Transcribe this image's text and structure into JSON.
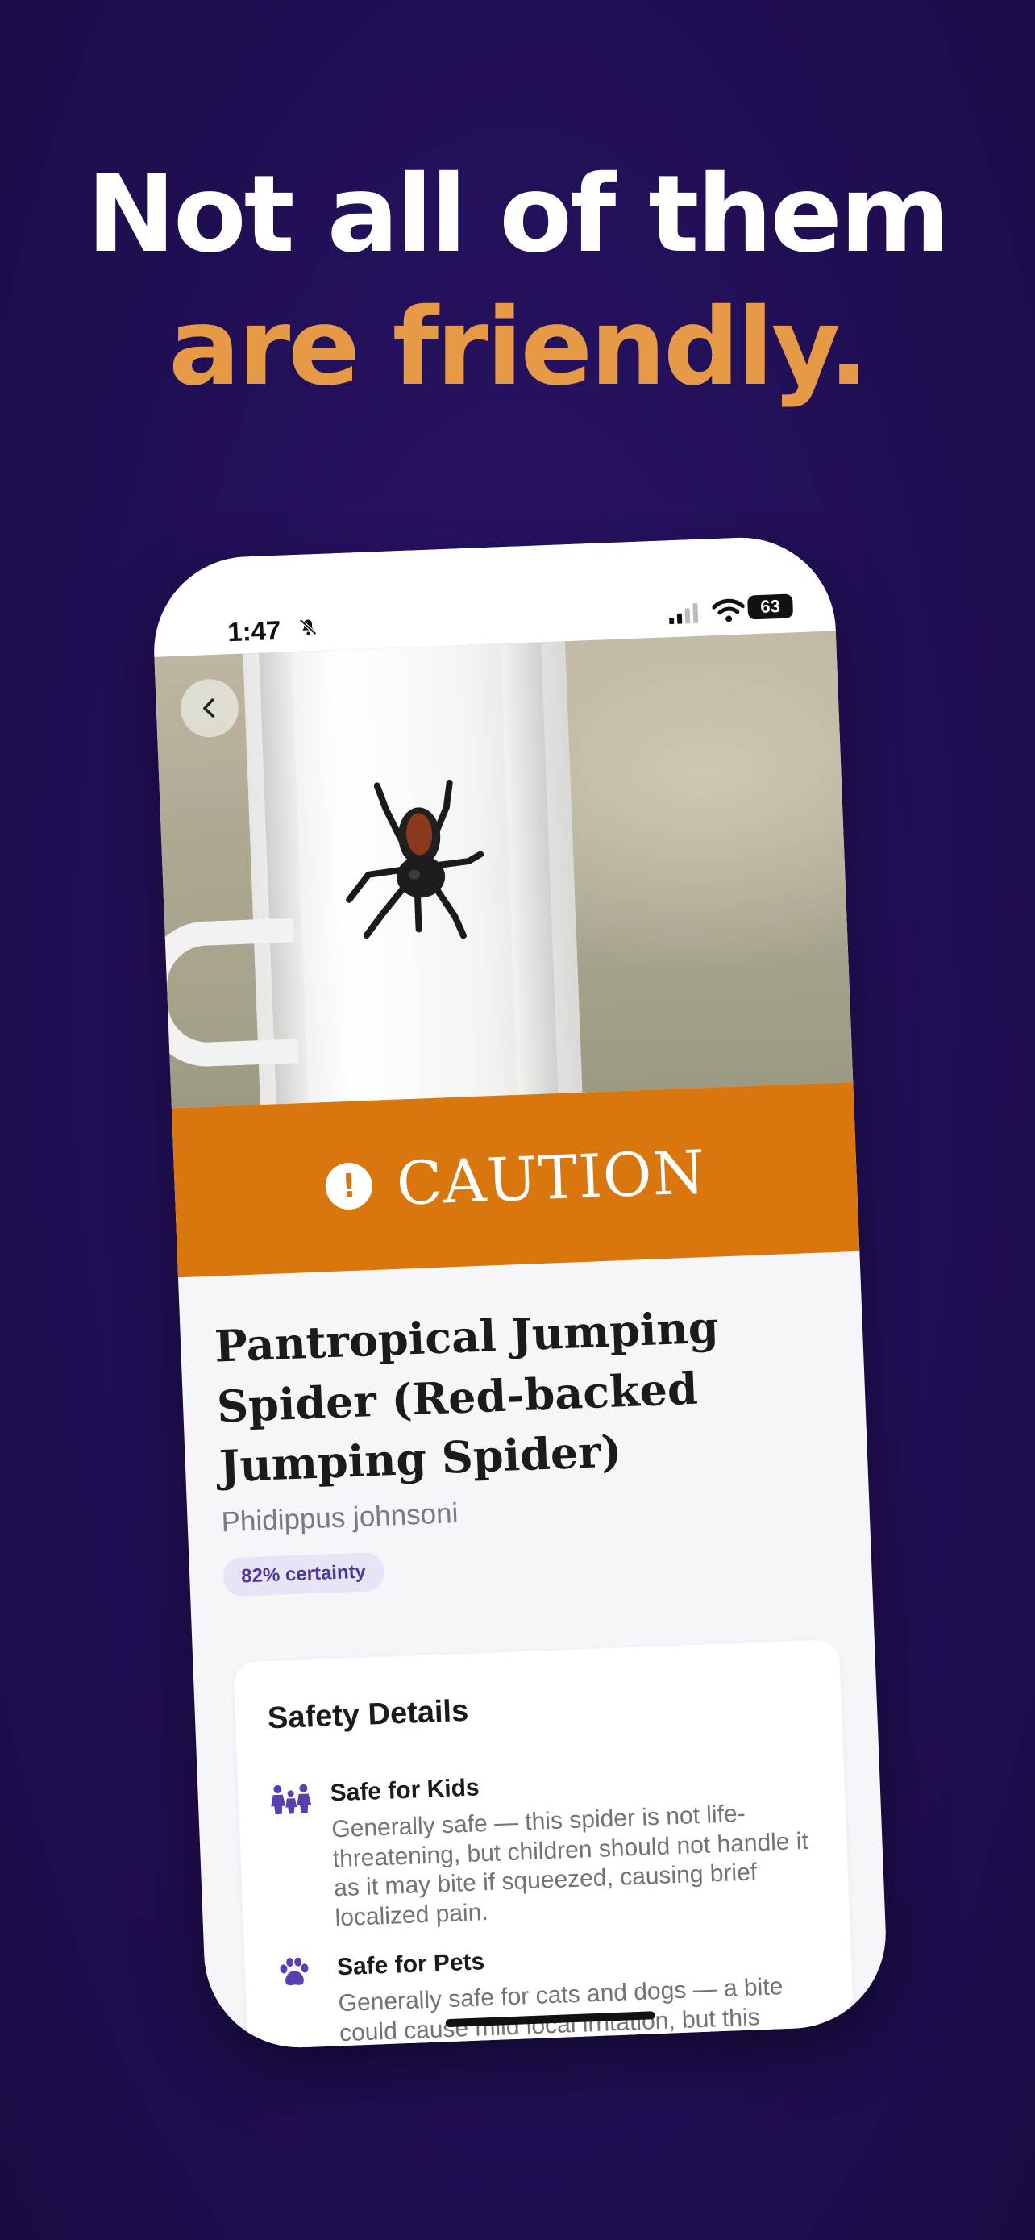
{
  "headline": {
    "line1": "Not all of them",
    "line2": "are friendly."
  },
  "status_bar": {
    "time": "1:47",
    "battery": "63"
  },
  "caution": {
    "label": "CAUTION"
  },
  "species": {
    "common_name": "Pantropical Jumping Spider (Red-backed Jumping Spider)",
    "scientific_name": "Phidippus johnsoni",
    "certainty": "82% certainty"
  },
  "safety": {
    "title": "Safety Details",
    "items": [
      {
        "icon": "family-icon",
        "title": "Safe for Kids",
        "body": "Generally safe — this spider is not life-threatening, but children should not handle it as it may bite if squeezed, causing brief localized pain."
      },
      {
        "icon": "paw-icon",
        "title": "Safe for Pets",
        "body": "Generally safe for cats and dogs — a bite could cause mild local irritation, but this spider poses no significant"
      }
    ]
  },
  "colors": {
    "background": "#23105a",
    "accent": "#e79a45",
    "caution": "#d9760e",
    "icon_purple": "#5a3fb0"
  }
}
